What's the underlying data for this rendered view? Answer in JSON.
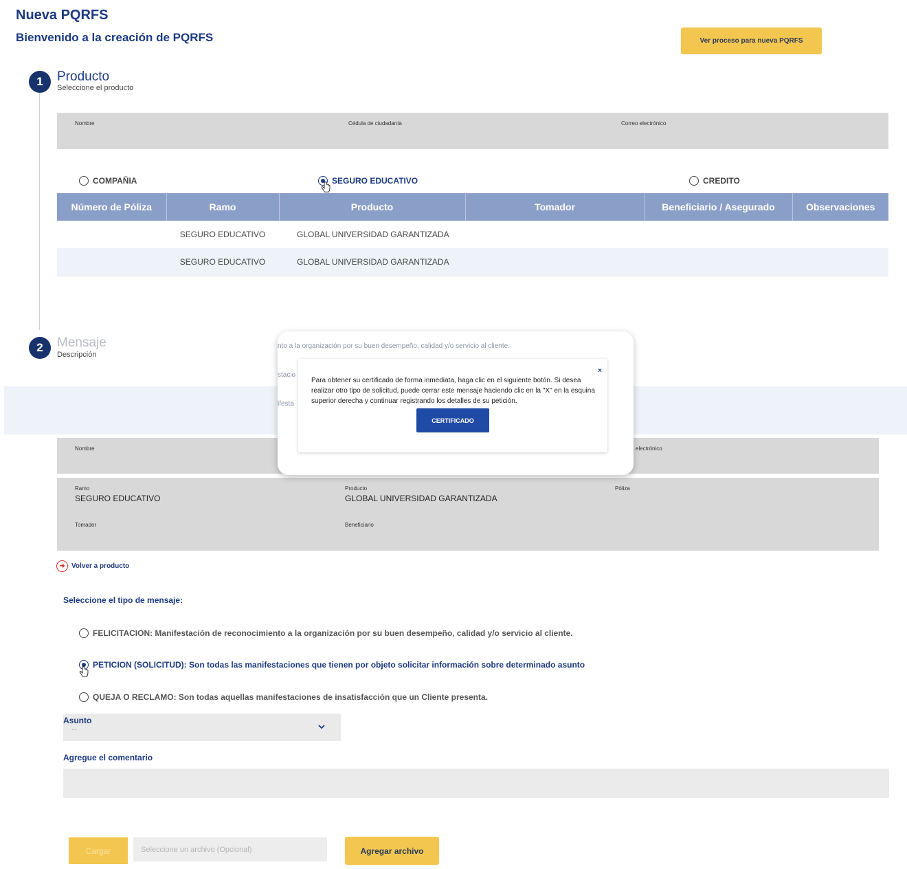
{
  "header": {
    "title": "Nueva PQRFS",
    "subtitle": "Bienvenido a la creación de PQRFS",
    "process_button": "Ver proceso para nueva PQRFS"
  },
  "step1": {
    "number": "1",
    "title": "Producto",
    "description": "Seleccione el producto",
    "info_labels": {
      "name": "Nombre",
      "id": "Cédula de ciudadanía",
      "email": "Correo electrónico"
    },
    "product_options": [
      {
        "label": "COMPAÑIA",
        "checked": false
      },
      {
        "label": "SEGURO EDUCATIVO",
        "checked": true
      },
      {
        "label": "CREDITO",
        "checked": false
      }
    ],
    "table": {
      "headers": [
        "Número de Póliza",
        "Ramo",
        "Producto",
        "Tomador",
        "Beneficiario / Asegurado",
        "Observaciones"
      ],
      "rows": [
        [
          "",
          "SEGURO EDUCATIVO",
          "GLOBAL UNIVERSIDAD GARANTIZADA",
          "",
          "",
          ""
        ],
        [
          "",
          "SEGURO EDUCATIVO",
          "GLOBAL UNIVERSIDAD GARANTIZADA",
          "",
          "",
          ""
        ]
      ]
    }
  },
  "step2": {
    "number": "2",
    "title": "Mensaje",
    "description": "Descripción",
    "info_labels": {
      "name": "Nombre",
      "email_partial": "electrónico"
    },
    "details": {
      "ramo_label": "Ramo",
      "ramo_value": "SEGURO EDUCATIVO",
      "producto_label": "Producto",
      "producto_value": "GLOBAL UNIVERSIDAD GARANTIZADA",
      "poliza_label": "Póliza",
      "tomador_label": "Tomador",
      "beneficiario_label": "Beneficiario"
    },
    "back_link": "Volver a producto",
    "message_type_label": "Seleccione el tipo de mensaje:",
    "message_types": [
      {
        "label": "FELICITACION: Manifestación de reconocimiento a la organización por su buen desempeño, calidad y/o servicio al cliente.",
        "checked": false
      },
      {
        "label": "PETICION (SOLICITUD): Son todas las manifestaciones que tienen por objeto solicitar información sobre determinado asunto",
        "checked": true
      },
      {
        "label": "QUEJA O RECLAMO: Son todas aquellas manifestaciones de insatisfacción que un Cliente presenta.",
        "checked": false
      }
    ],
    "asunto_label": "Asunto",
    "asunto_value": "...",
    "comment_label": "Agregue el comentario",
    "load_button": "Cargar",
    "file_placeholder": "Seleccione un archivo (Opcional)",
    "add_file_button": "Agregar archivo"
  },
  "modal": {
    "background_text_1": "nto a la organización por su buen desempeño, calidad y/o servicio al cliente.",
    "background_text_2": "stacio",
    "background_text_3": "ifesta",
    "message": "Para obtener su certificado de forma inmediata, haga clic en el siguiente botón. Si desea realizar otro tipo de solicitud, puede cerrar este mensaje haciendo clic en la \"X\" en la esquina superior derecha y continuar registrando los detalles de su petición.",
    "close_label": "×",
    "certificate_button": "CERTIFICADO"
  },
  "colors": {
    "brand_navy": "#1c3a82",
    "accent_yellow": "#f3c64f",
    "table_header": "#8a9fc8",
    "certificate_button": "#1f4aa6"
  }
}
